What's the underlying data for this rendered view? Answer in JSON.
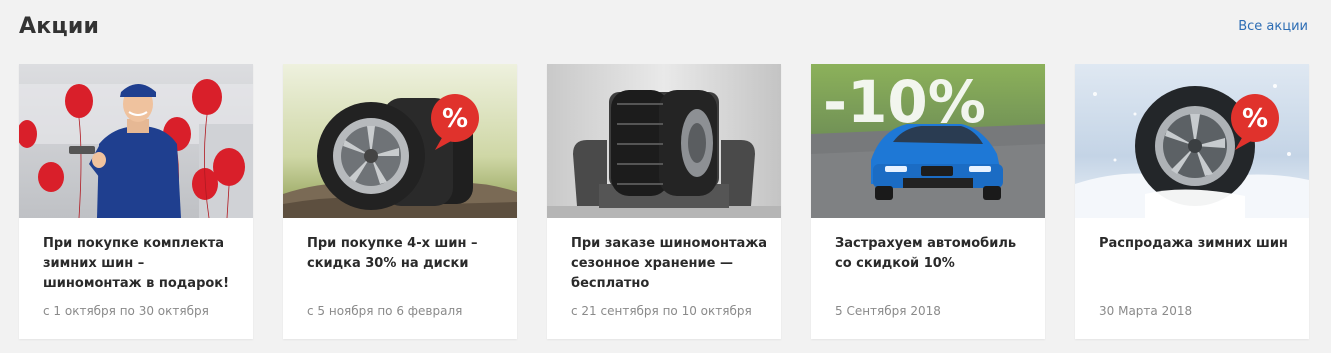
{
  "section": {
    "title": "Акции",
    "all_link": "Все акции"
  },
  "promos": [
    {
      "title": "При покупке комплекта зимних шин – шиномонтаж в подарок!",
      "dates": "с 1 октября по 30 октября",
      "image_icon": "mechanic-balloons-image"
    },
    {
      "title": "При покупке 4-х шин – скидка 30% на диски",
      "dates": "с 5 ноября по 6 февраля",
      "image_icon": "tires-discount-image",
      "badge": "%"
    },
    {
      "title": "При заказе шиномонтажа сезонное хранение — бесплатно",
      "dates": "с 21 сентября по 10 октября",
      "image_icon": "tires-armchair-image"
    },
    {
      "title": "Застрахуем автомобиль со скидкой 10%",
      "dates": "5 Сентября 2018",
      "image_icon": "blue-car-image",
      "badge": "-10%"
    },
    {
      "title": "Распродажа зимних шин",
      "dates": "30 Марта 2018",
      "image_icon": "winter-tire-image",
      "badge": "%"
    }
  ],
  "colors": {
    "link": "#2d6db4",
    "badge_red": "#e0322c",
    "background": "#f2f2f2"
  }
}
